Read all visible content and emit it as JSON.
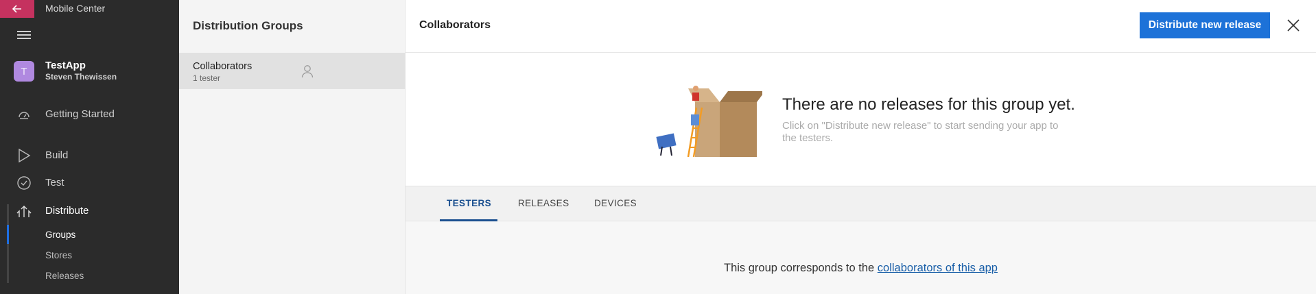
{
  "nav": {
    "brand": "Mobile Center",
    "app": {
      "initial": "T",
      "name": "TestApp",
      "owner": "Steven Thewissen"
    },
    "items": [
      {
        "label": "Getting Started",
        "icon": "gauge-icon"
      },
      {
        "label": "Build",
        "icon": "play-icon"
      },
      {
        "label": "Test",
        "icon": "check-circle-icon"
      },
      {
        "label": "Distribute",
        "icon": "distribute-icon"
      }
    ],
    "subitems": [
      "Groups",
      "Stores",
      "Releases"
    ]
  },
  "groups": {
    "title": "Distribution Groups",
    "list": [
      {
        "name": "Collaborators",
        "count": "1 tester"
      }
    ]
  },
  "main": {
    "title": "Collaborators",
    "primary_button": "Distribute new release",
    "empty_title": "There are no releases for this group yet.",
    "empty_hint": "Click on \"Distribute new release\" to start sending your app to the testers.",
    "tabs": [
      "TESTERS",
      "RELEASES",
      "DEVICES"
    ],
    "note_prefix": "This group corresponds to the ",
    "note_link": "collaborators of this app"
  },
  "colors": {
    "accent": "#1d72d8",
    "back_button": "#c5325f",
    "nav_bg": "#2b2b2b",
    "avatar": "#b089e0"
  }
}
